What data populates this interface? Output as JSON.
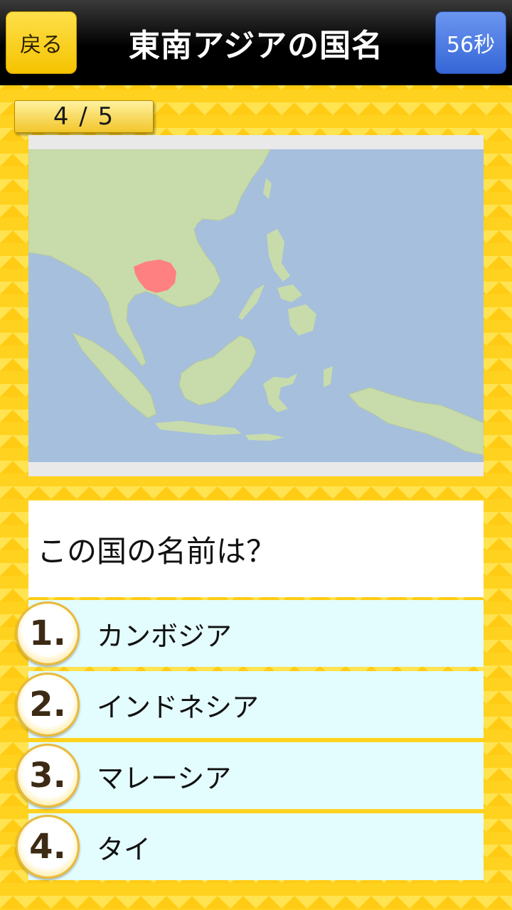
{
  "header": {
    "back_label": "戻る",
    "title": "東南アジアの国名",
    "timer_label": "56秒"
  },
  "progress": {
    "text": "4 / 5"
  },
  "map": {
    "ocean_color": "#a5bfdd",
    "land_color": "#c8dbab",
    "highlight_color": "#ff8080"
  },
  "question": {
    "text": "この国の名前は？"
  },
  "choices": [
    {
      "number": "1.",
      "label": "カンボジア"
    },
    {
      "number": "2.",
      "label": "インドネシア"
    },
    {
      "number": "3.",
      "label": "マレーシア"
    },
    {
      "number": "4.",
      "label": "タイ"
    }
  ]
}
